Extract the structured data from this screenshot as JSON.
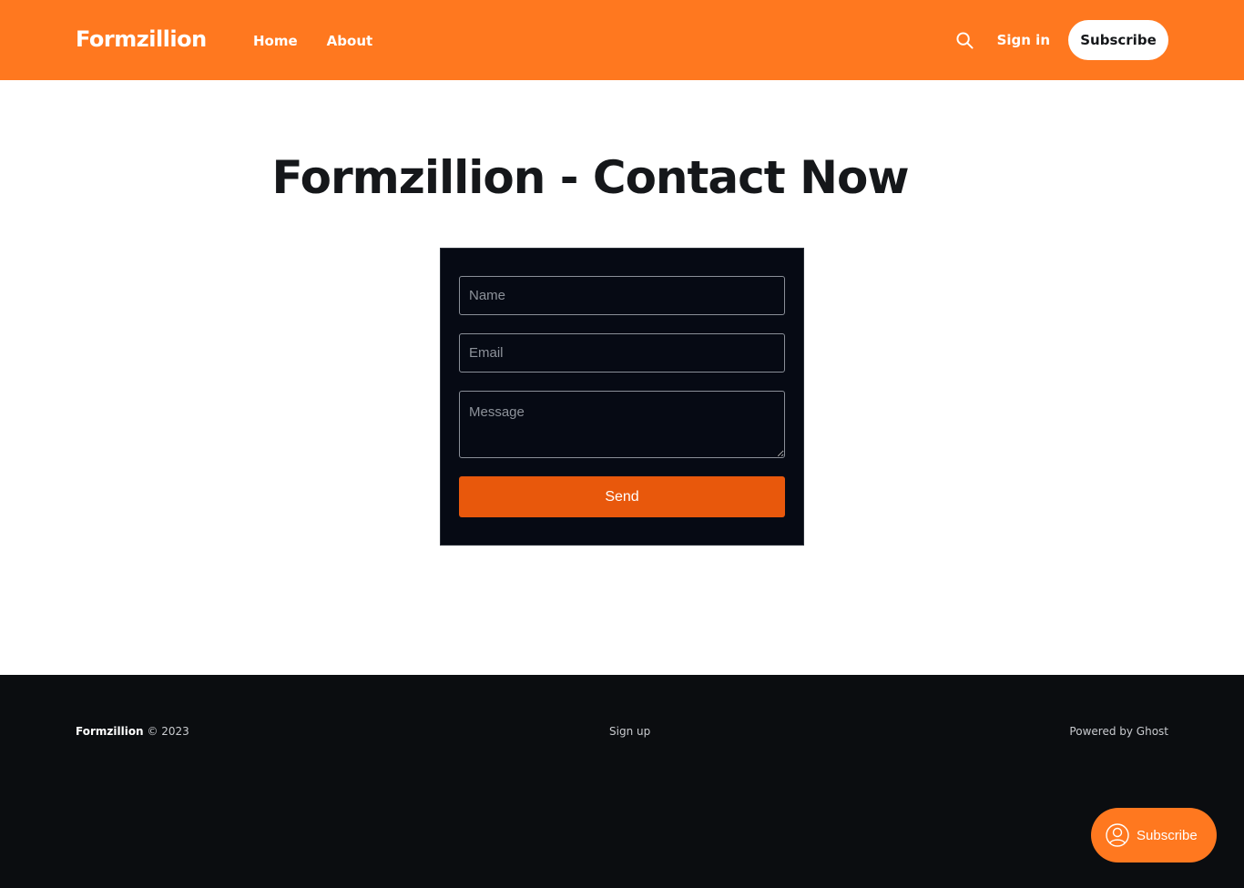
{
  "header": {
    "logo": "Formzillion",
    "nav": [
      {
        "label": "Home"
      },
      {
        "label": "About"
      }
    ],
    "signin_label": "Sign in",
    "subscribe_label": "Subscribe",
    "search_icon": "search-icon",
    "background_color": "#ff781f"
  },
  "main": {
    "title": "Formzillion - Contact Now",
    "form": {
      "name_placeholder": "Name",
      "email_placeholder": "Email",
      "message_placeholder": "Message",
      "send_label": "Send",
      "background_color": "#060a14",
      "button_color": "#e8580c"
    }
  },
  "footer": {
    "brand": "Formzillion",
    "copyright": "© 2023",
    "signup_label": "Sign up",
    "powered_by": "Powered by Ghost",
    "background_color": "#0b0d10"
  },
  "portal": {
    "label": "Subscribe",
    "icon": "user-icon"
  }
}
